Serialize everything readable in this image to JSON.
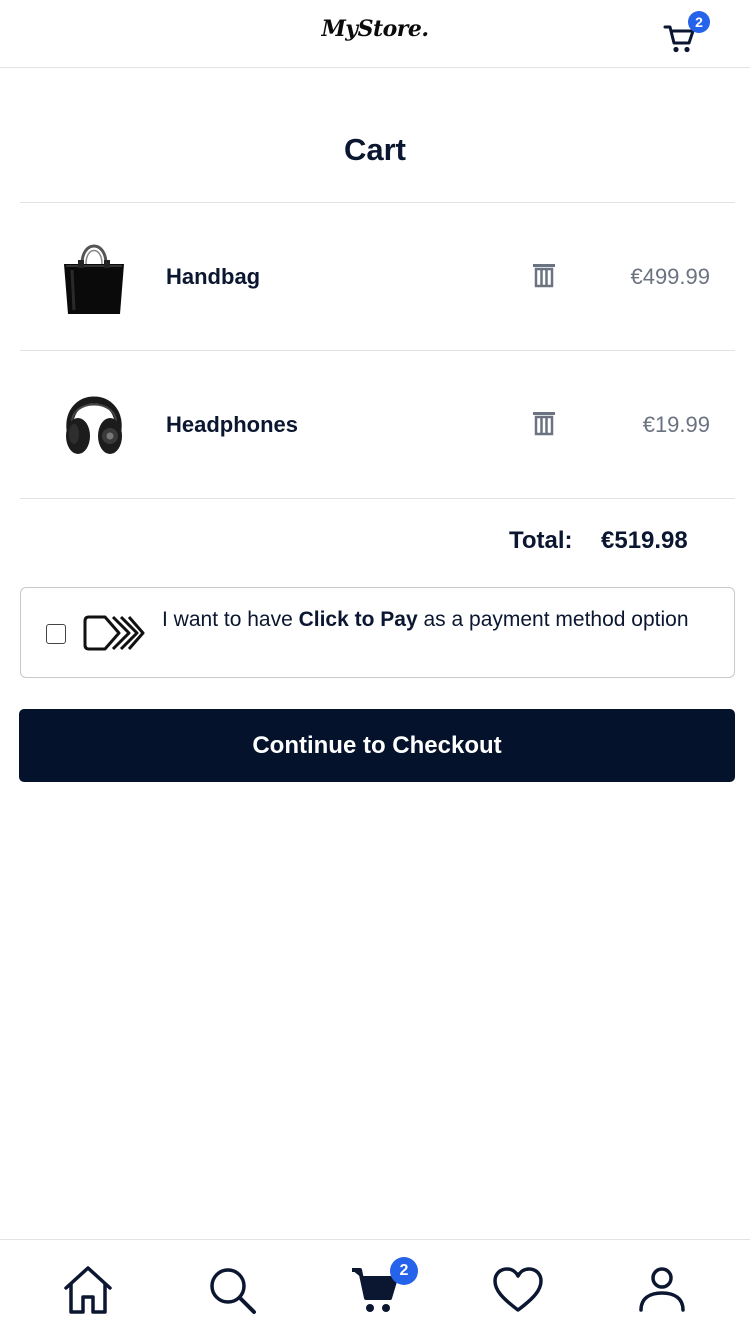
{
  "header": {
    "logo_text": "MyStore.",
    "cart_count": "2"
  },
  "page": {
    "title": "Cart"
  },
  "cart": {
    "items": [
      {
        "name": "Handbag",
        "price": "€499.99",
        "image": "handbag-image"
      },
      {
        "name": "Headphones",
        "price": "€19.99",
        "image": "headphones-image"
      }
    ],
    "total_label": "Total:",
    "total_value": "€519.98"
  },
  "click_to_pay": {
    "text_before": "I want to have ",
    "text_bold": "Click to Pay",
    "text_after": " as a payment method option",
    "checked": false
  },
  "checkout": {
    "button_label": "Continue to Checkout"
  },
  "bottom_nav": {
    "items": [
      "home-icon",
      "search-icon",
      "cart-icon",
      "heart-icon",
      "user-icon"
    ],
    "cart_count": "2"
  },
  "colors": {
    "primary": "#05122b",
    "badge": "#2563eb",
    "price_gray": "#6b7280",
    "divider": "#e3e3e3"
  }
}
